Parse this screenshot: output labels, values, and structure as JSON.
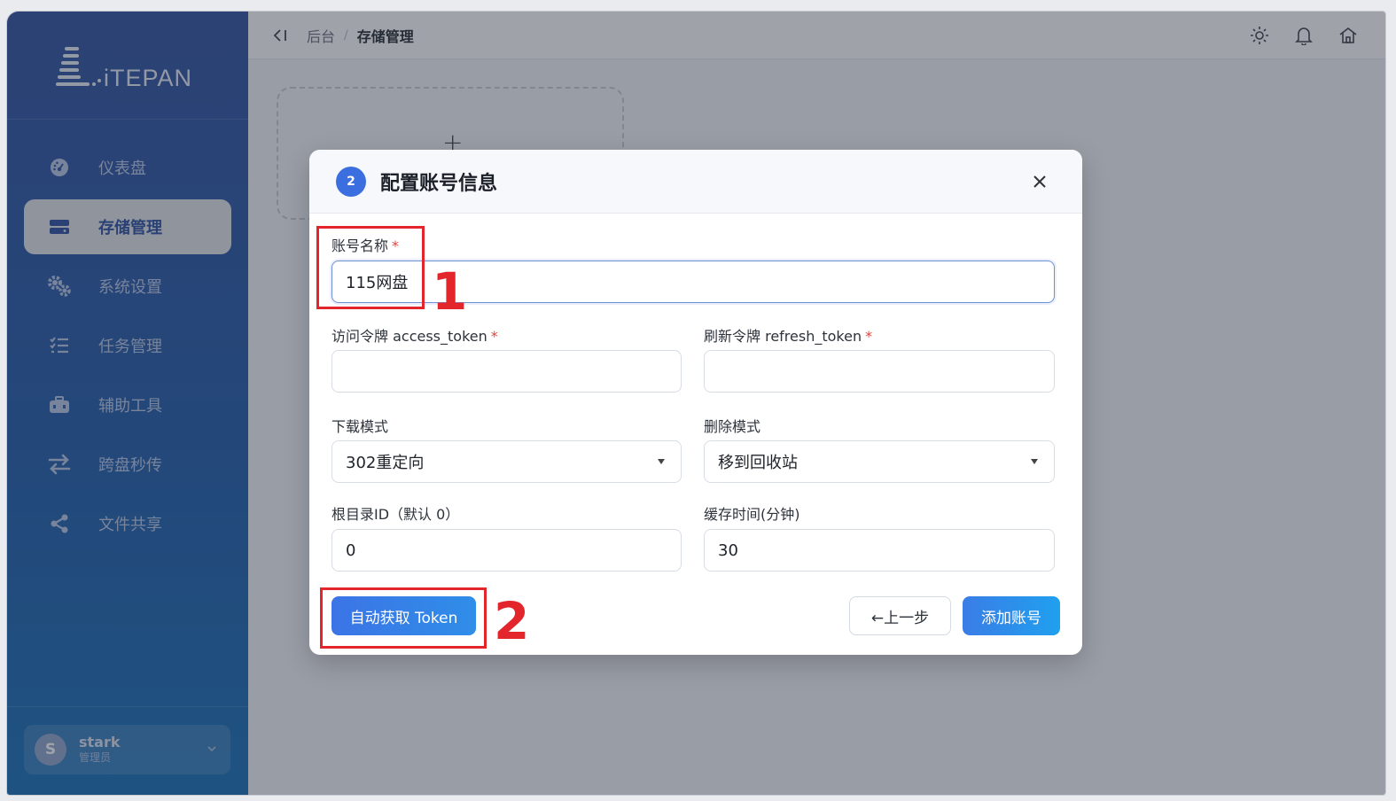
{
  "sidebar": {
    "logo_text": "iTEPAN",
    "items": [
      {
        "label": "仪表盘",
        "icon": "dashboard-icon"
      },
      {
        "label": "存储管理",
        "icon": "storage-icon",
        "active": true
      },
      {
        "label": "系统设置",
        "icon": "gears-icon"
      },
      {
        "label": "任务管理",
        "icon": "task-list-icon"
      },
      {
        "label": "辅助工具",
        "icon": "toolbox-icon"
      },
      {
        "label": "跨盘秒传",
        "icon": "transfer-arrows-icon"
      },
      {
        "label": "文件共享",
        "icon": "share-icon"
      }
    ],
    "user": {
      "avatar_letter": "S",
      "name": "stark",
      "role": "管理员"
    }
  },
  "topbar": {
    "breadcrumb": [
      "后台",
      "存储管理"
    ],
    "separator": "/",
    "icons": [
      "sun-icon",
      "bell-icon",
      "home-icon"
    ]
  },
  "modal": {
    "step": "2",
    "title": "配置账号信息",
    "fields": {
      "account_name": {
        "label": "账号名称",
        "value": "115网盘",
        "required": true
      },
      "access_token": {
        "label": "访问令牌 access_token",
        "value": "",
        "required": true
      },
      "refresh_token": {
        "label": "刷新令牌 refresh_token",
        "value": "",
        "required": true
      },
      "download_mode": {
        "label": "下载模式",
        "value": "302重定向"
      },
      "delete_mode": {
        "label": "删除模式",
        "value": "移到回收站"
      },
      "root_id": {
        "label": "根目录ID（默认 0）",
        "value": "0"
      },
      "cache_time": {
        "label": "缓存时间(分钟)",
        "value": "30"
      }
    },
    "buttons": {
      "auto_token": "自动获取 Token",
      "prev": "←上一步",
      "add": "添加账号"
    },
    "required_mark": "*"
  },
  "annotations": [
    "1",
    "2"
  ],
  "colors": {
    "sidebar_top": "#2f4f9f",
    "sidebar_bottom": "#1570b7",
    "primary": "#3b6fe0",
    "annotation_red": "#e3262b"
  }
}
